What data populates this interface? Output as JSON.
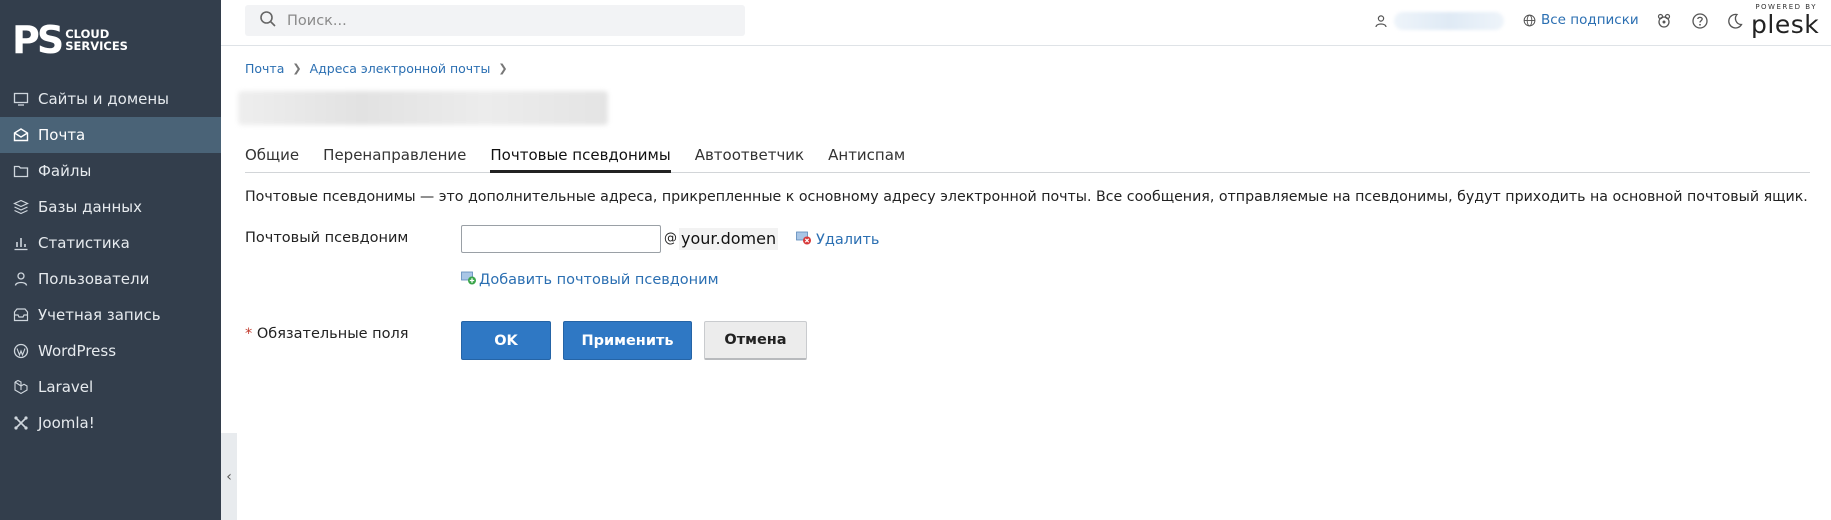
{
  "logo": {
    "mark": "PS",
    "line1": "CLOUD",
    "line2": "SERVICES"
  },
  "sidebar": {
    "items": [
      {
        "label": "Сайты и домены",
        "icon": "monitor-icon",
        "active": false
      },
      {
        "label": "Почта",
        "icon": "envelope-icon",
        "active": true
      },
      {
        "label": "Файлы",
        "icon": "folder-icon",
        "active": false
      },
      {
        "label": "Базы данных",
        "icon": "database-icon",
        "active": false
      },
      {
        "label": "Статистика",
        "icon": "bar-chart-icon",
        "active": false
      },
      {
        "label": "Пользователи",
        "icon": "user-icon",
        "active": false
      },
      {
        "label": "Учетная запись",
        "icon": "account-icon",
        "active": false
      },
      {
        "label": "WordPress",
        "icon": "wordpress-icon",
        "active": false
      },
      {
        "label": "Laravel",
        "icon": "laravel-icon",
        "active": false
      },
      {
        "label": "Joomla!",
        "icon": "joomla-icon",
        "active": false
      }
    ],
    "collapse_glyph": "‹"
  },
  "topbar": {
    "search_placeholder": "Поиск...",
    "subscriptions_label": "Все подписки",
    "powered_by": "POWERED BY",
    "brand": "plesk"
  },
  "breadcrumb": {
    "items": [
      "Почта",
      "Адреса электронной почты"
    ]
  },
  "tabs": [
    {
      "label": "Общие",
      "active": false
    },
    {
      "label": "Перенаправление",
      "active": false
    },
    {
      "label": "Почтовые псевдонимы",
      "active": true
    },
    {
      "label": "Автоответчик",
      "active": false
    },
    {
      "label": "Антиспам",
      "active": false
    }
  ],
  "form": {
    "description": "Почтовые псевдонимы — это дополнительные адреса, прикрепленные к основному адресу электронной почты. Все сообщения, отправляемые на псевдонимы, будут приходить на основной почтовый ящик.",
    "alias_label": "Почтовый псевдоним",
    "alias_value": "",
    "at_sign": "@",
    "domain": "your.domen",
    "delete_label": "Удалить",
    "add_label": "Добавить почтовый псевдоним",
    "required_star": "*",
    "required_label": "Обязательные поля",
    "ok_label": "OK",
    "apply_label": "Применить",
    "cancel_label": "Отмена"
  },
  "colors": {
    "sidebar_bg": "#333e4c",
    "sidebar_active": "#4a6377",
    "link": "#2b6fb2",
    "primary_button": "#2f78c4"
  }
}
